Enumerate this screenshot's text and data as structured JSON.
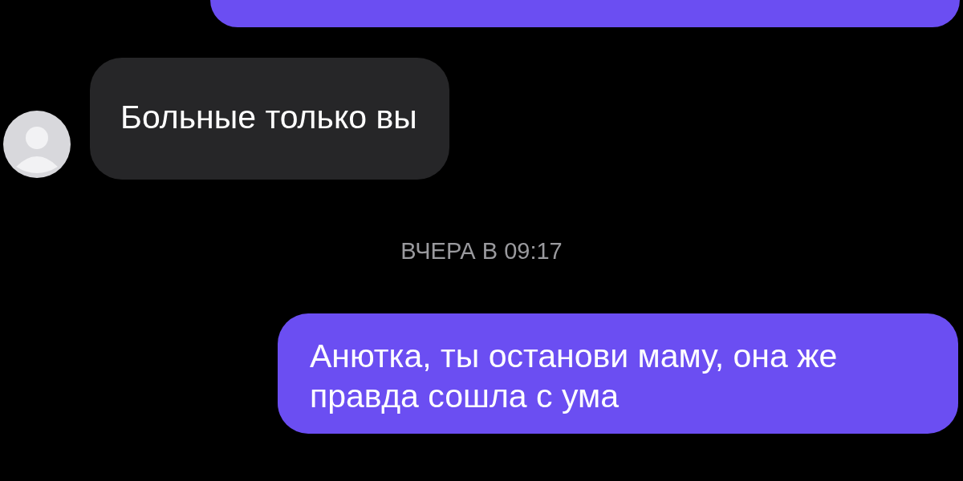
{
  "messages": [
    {
      "kind": "outgoing_cut"
    },
    {
      "kind": "incoming",
      "text": "Больные только вы"
    },
    {
      "kind": "timestamp",
      "text": "ВЧЕРА В 09:17"
    },
    {
      "kind": "outgoing",
      "text": "Анютка, ты останови маму, она же правда сошла с ума"
    }
  ]
}
